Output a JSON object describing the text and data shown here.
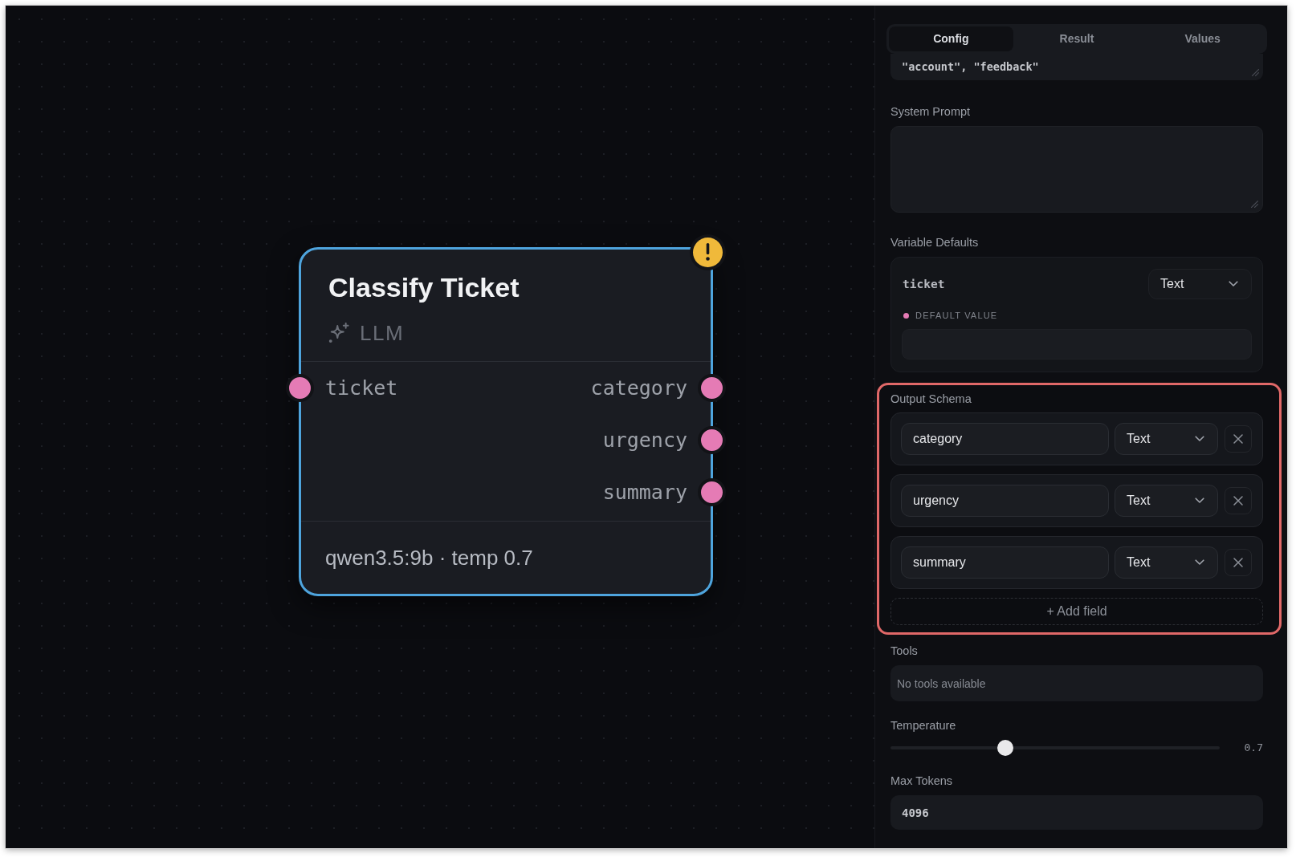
{
  "canvas": {
    "node": {
      "title": "Classify Ticket",
      "type_label": "LLM",
      "selected": true,
      "warning": true,
      "inputs": [
        {
          "label": "ticket"
        }
      ],
      "outputs": [
        {
          "label": "category"
        },
        {
          "label": "urgency"
        },
        {
          "label": "summary"
        }
      ],
      "footer": "qwen3.5:9b · temp 0.7"
    }
  },
  "inspector": {
    "tabs": [
      {
        "label": "Config",
        "selected": true
      },
      {
        "label": "Result",
        "selected": false
      },
      {
        "label": "Values",
        "selected": false
      }
    ],
    "sections": [
      {
        "kind": "textarea",
        "value": "\"account\", \"feedback\"",
        "highlighted": false
      },
      {
        "kind": "textarea",
        "label": "System Prompt",
        "highlighted": false
      },
      {
        "kind": "variables",
        "label": "Variable Defaults",
        "highlighted": false,
        "variables": [
          {
            "name": "ticket",
            "type": "Text",
            "default_label": "DEFAULT VALUE"
          }
        ]
      },
      {
        "kind": "schema",
        "label": "Output Schema",
        "highlighted": true,
        "fields": [
          {
            "name": "category",
            "type": "Text"
          },
          {
            "name": "urgency",
            "type": "Text"
          },
          {
            "name": "summary",
            "type": "Text"
          }
        ],
        "add_label": "+ Add field"
      },
      {
        "kind": "empty",
        "label": "Tools",
        "message": "No tools available",
        "highlighted": false
      },
      {
        "kind": "slider",
        "label": "Temperature",
        "level": 0.35,
        "reading": "0.7",
        "highlighted": false
      },
      {
        "kind": "input",
        "label": "Max Tokens",
        "value": "4096",
        "highlighted": false
      }
    ]
  }
}
